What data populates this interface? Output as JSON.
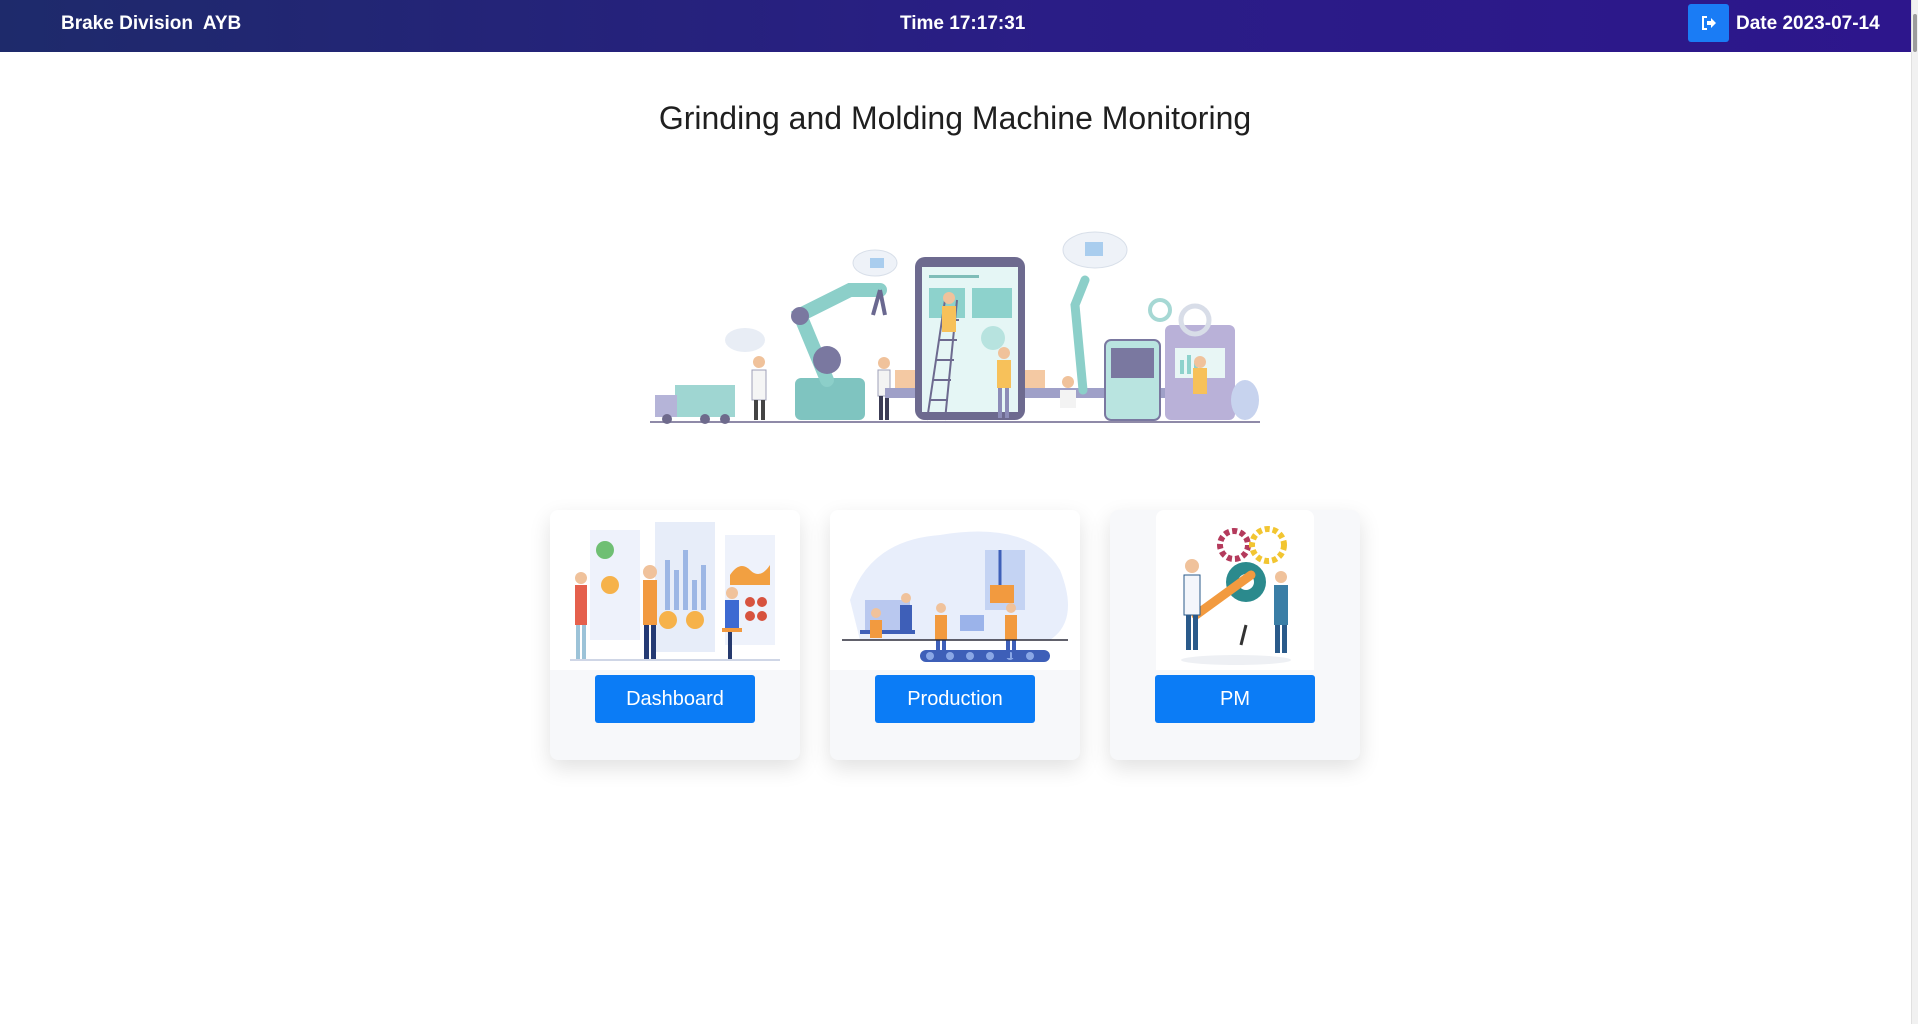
{
  "header": {
    "brand": "Brake Division  AYB",
    "time_label": "Time",
    "time_value": "17:17:31",
    "date_label": "Date",
    "date_value": "2023-07-14",
    "logout_icon": "sign-out-icon"
  },
  "main": {
    "title": "Grinding and Molding Machine Monitoring",
    "hero_illustration": "smart-factory-illustration"
  },
  "cards": [
    {
      "button_label": "Dashboard",
      "illustration": "dashboard-analytics-illustration"
    },
    {
      "button_label": "Production",
      "illustration": "production-line-illustration"
    },
    {
      "button_label": "PM",
      "illustration": "maintenance-gears-illustration"
    }
  ],
  "colors": {
    "header_start": "#1e2a6b",
    "header_end": "#2d168c",
    "accent_blue": "#0b7cf6",
    "card_bg": "#f7f8fa"
  }
}
